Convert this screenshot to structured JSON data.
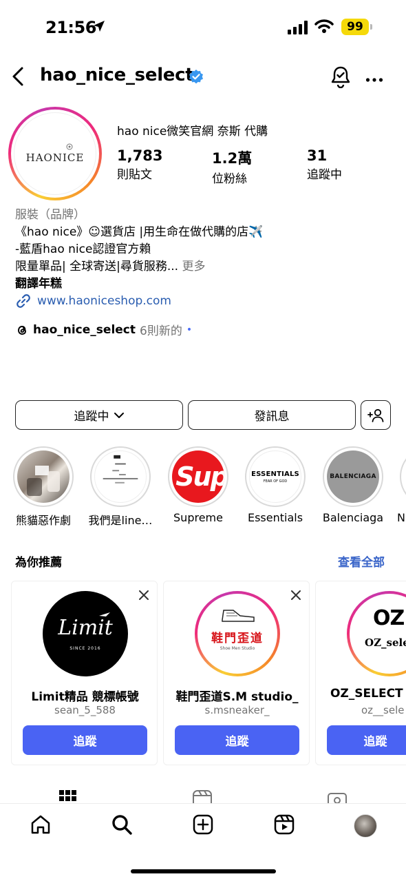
{
  "status_bar": {
    "time": "21:56",
    "battery": "99"
  },
  "header": {
    "username": "hao_nice_select"
  },
  "profile": {
    "avatar_text": "HAONICE",
    "display_name": "hao nice微笑官網 奈斯 代購",
    "stats": [
      {
        "value": "1,783",
        "label": "則貼文"
      },
      {
        "value": "1.2萬",
        "label": "位粉絲"
      },
      {
        "value": "31",
        "label": "追蹤中"
      }
    ],
    "category": "服裝（品牌）",
    "bio_lines": [
      "《hao nice》☺選貨店 |用生命在做代購的店✈️",
      "-藍盾hao nice認證官方賴",
      "限量單品| 全球寄送|尋貨服務..."
    ],
    "more_label": "更多",
    "translate_label": "翻譯年糕",
    "website": "www.haoniceshop.com",
    "threads_name": "hao_nice_select",
    "threads_count": "6則新的"
  },
  "actions": {
    "follow_label": "追蹤中",
    "message_label": "發訊息"
  },
  "highlights": [
    {
      "label": "熊貓惡作劇"
    },
    {
      "label": "我們是line…"
    },
    {
      "label": "Supreme",
      "img_text": "Sup"
    },
    {
      "label": "Essentials",
      "img_text": "ESSENTIALS",
      "img_sub": "FEAR OF GOD"
    },
    {
      "label": "Balenciaga",
      "img_text": "BALENCIAGA"
    },
    {
      "label": "N"
    }
  ],
  "suggestions": {
    "title": "為你推薦",
    "see_all": "查看全部",
    "cards": [
      {
        "name": "Limit精品 競標帳號",
        "handle": "sean_5_588",
        "follow": "追蹤",
        "logo": "Limit",
        "logo_sub": "SINCE 2016"
      },
      {
        "name": "鞋門歪道S.M studio_",
        "handle": "s.msneaker_",
        "follow": "追蹤",
        "logo": "鞋門歪道",
        "logo_sub": "Shoe Men Studio"
      },
      {
        "name": "OZ_SELECT",
        "handle": "oz__sele",
        "follow": "追蹤",
        "logo": "OZ",
        "logo_sub": "OZ_sele"
      }
    ]
  },
  "colors": {
    "accent": "#4a63f3",
    "link": "#2a5db0",
    "verified": "#3897f0"
  }
}
